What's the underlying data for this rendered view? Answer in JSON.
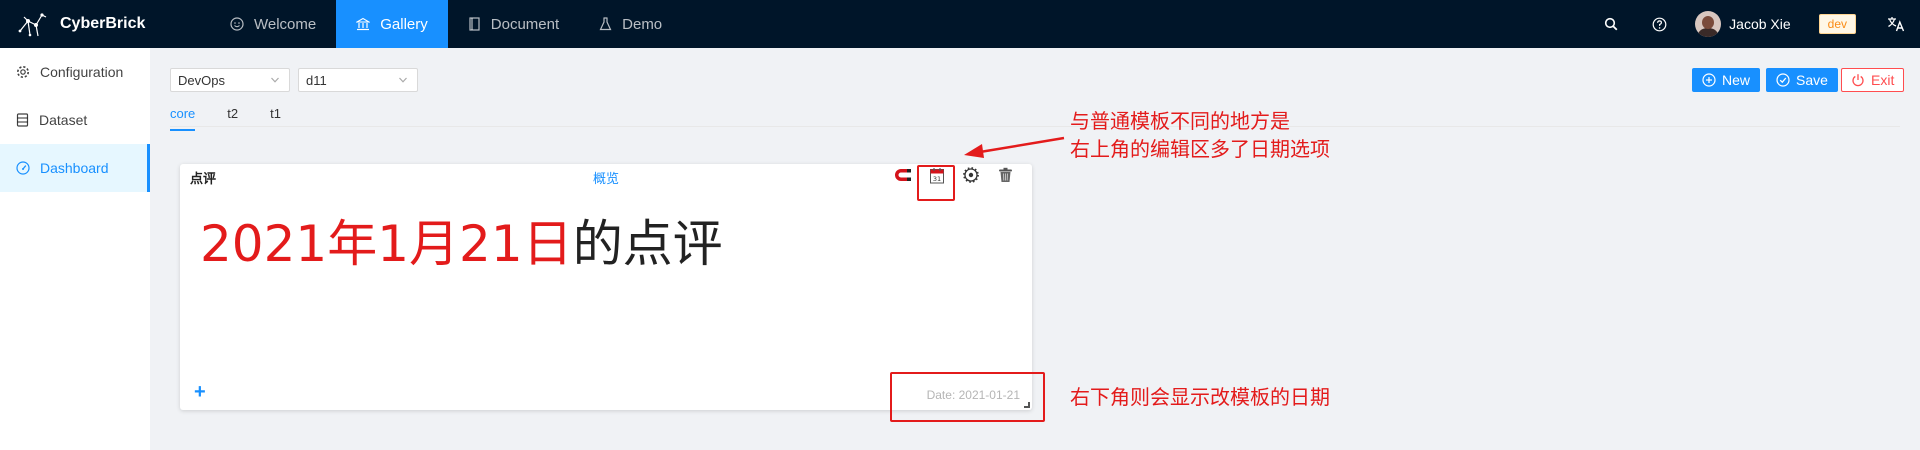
{
  "header": {
    "app_name": "CyberBrick",
    "nav": [
      {
        "label": "Welcome",
        "icon": "smile-icon"
      },
      {
        "label": "Gallery",
        "icon": "bank-icon",
        "active": true
      },
      {
        "label": "Document",
        "icon": "book-icon"
      },
      {
        "label": "Demo",
        "icon": "flask-icon"
      }
    ],
    "user_name": "Jacob Xie",
    "env_tag": "dev"
  },
  "sidebar": {
    "items": [
      {
        "label": "Configuration",
        "icon": "gear-icon"
      },
      {
        "label": "Dataset",
        "icon": "database-icon"
      },
      {
        "label": "Dashboard",
        "icon": "dashboard-icon",
        "active": true
      }
    ]
  },
  "toolbar": {
    "category_select": "DevOps",
    "dashboard_select": "d11",
    "new_label": "New",
    "save_label": "Save",
    "exit_label": "Exit"
  },
  "tabs": [
    {
      "label": "core",
      "active": true
    },
    {
      "label": "t2"
    },
    {
      "label": "t1"
    }
  ],
  "card": {
    "title": "点评",
    "link": "概览",
    "heading_date": "2021年1月21日",
    "heading_suffix": "的点评",
    "add_symbol": "+",
    "date_text": "Date: 2021-01-21"
  },
  "annotations": {
    "top_line1": "与普通模板不同的地方是",
    "top_line2": "右上角的编辑区多了日期选项",
    "bottom": "右下角则会显示改模板的日期"
  },
  "colors": {
    "header_bg": "#001529",
    "primary": "#1890ff",
    "danger": "#ff4d4f",
    "annotation_red": "#e31b1b"
  }
}
